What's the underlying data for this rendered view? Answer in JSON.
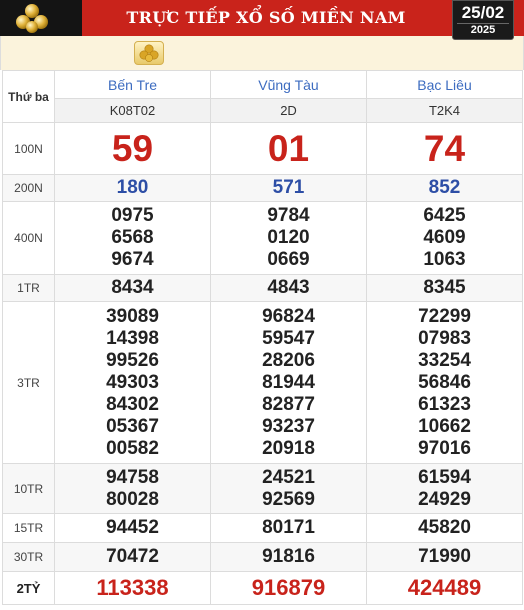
{
  "header": {
    "title": "TRỰC TIẾP XỔ SỐ MIỀN NAM",
    "date_day": "25/02",
    "date_year": "2025",
    "logo_icon": "gold-balls-icon",
    "colors": {
      "banner": "#c9231b",
      "accent": "#c8231b",
      "blue": "#2d4ea6"
    }
  },
  "table": {
    "day_label": "Thứ ba",
    "provinces": [
      {
        "name": "Bến Tre",
        "code": "K08T02"
      },
      {
        "name": "Vũng Tàu",
        "code": "2D"
      },
      {
        "name": "Bạc Liêu",
        "code": "T2K4"
      }
    ],
    "prizes": [
      {
        "label": "100N",
        "cols": [
          [
            "59"
          ],
          [
            "01"
          ],
          [
            "74"
          ]
        ]
      },
      {
        "label": "200N",
        "cols": [
          [
            "180"
          ],
          [
            "571"
          ],
          [
            "852"
          ]
        ]
      },
      {
        "label": "400N",
        "cols": [
          [
            "0975",
            "6568",
            "9674"
          ],
          [
            "9784",
            "0120",
            "0669"
          ],
          [
            "6425",
            "4609",
            "1063"
          ]
        ]
      },
      {
        "label": "1TR",
        "cols": [
          [
            "8434"
          ],
          [
            "4843"
          ],
          [
            "8345"
          ]
        ]
      },
      {
        "label": "3TR",
        "cols": [
          [
            "39089",
            "14398",
            "99526",
            "49303",
            "84302",
            "05367",
            "00582"
          ],
          [
            "96824",
            "59547",
            "28206",
            "81944",
            "82877",
            "93237",
            "20918"
          ],
          [
            "72299",
            "07983",
            "33254",
            "56846",
            "61323",
            "10662",
            "97016"
          ]
        ]
      },
      {
        "label": "10TR",
        "cols": [
          [
            "94758",
            "80028"
          ],
          [
            "24521",
            "92569"
          ],
          [
            "61594",
            "24929"
          ]
        ]
      },
      {
        "label": "15TR",
        "cols": [
          [
            "94452"
          ],
          [
            "80171"
          ],
          [
            "45820"
          ]
        ]
      },
      {
        "label": "30TR",
        "cols": [
          [
            "70472"
          ],
          [
            "91816"
          ],
          [
            "71990"
          ]
        ]
      },
      {
        "label": "2TỶ",
        "cols": [
          [
            "113338"
          ],
          [
            "916879"
          ],
          [
            "424489"
          ]
        ]
      }
    ]
  }
}
